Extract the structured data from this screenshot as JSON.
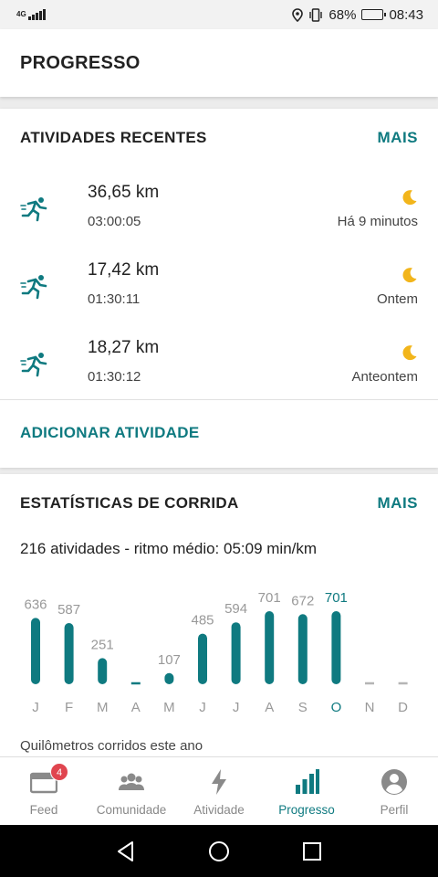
{
  "status_bar": {
    "network": "4G",
    "battery": "68%",
    "battery_level": 0.68,
    "time": "08:43"
  },
  "header": {
    "title": "PROGRESSO"
  },
  "recent": {
    "title": "ATIVIDADES RECENTES",
    "more": "MAIS",
    "items": [
      {
        "distance": "36,65 km",
        "duration": "03:00:05",
        "when": "Há 9 minutos",
        "icon": "runner-icon"
      },
      {
        "distance": "17,42 km",
        "duration": "01:30:11",
        "when": "Ontem",
        "icon": "runner-icon"
      },
      {
        "distance": "18,27 km",
        "duration": "01:30:12",
        "when": "Anteontem",
        "icon": "runner-icon"
      }
    ],
    "add_label": "ADICIONAR ATIVIDADE"
  },
  "stats": {
    "title": "ESTATÍSTICAS DE CORRIDA",
    "more": "MAIS",
    "summary": "216 atividades - ritmo médio: 05:09 min/km",
    "caption": "Quilômetros corridos este ano"
  },
  "chart_data": {
    "type": "bar",
    "categories": [
      "J",
      "F",
      "M",
      "A",
      "M",
      "J",
      "J",
      "A",
      "S",
      "O",
      "N",
      "D"
    ],
    "values": [
      636,
      587,
      251,
      0,
      107,
      485,
      594,
      701,
      672,
      701,
      0,
      0
    ],
    "labels": [
      "636",
      "587",
      "251",
      "",
      "107",
      "485",
      "594",
      "701",
      "672",
      "701",
      "",
      ""
    ],
    "highlight_index": 9,
    "title": "",
    "xlabel": "",
    "ylabel": "",
    "colors": {
      "bar": "#0f7a80",
      "empty": "#b5b5b5",
      "label": "#999999",
      "highlight_label": "#0f7a80"
    }
  },
  "bottom_nav": {
    "items": [
      {
        "label": "Feed",
        "icon": "feed-icon",
        "badge": "4"
      },
      {
        "label": "Comunidade",
        "icon": "community-icon"
      },
      {
        "label": "Atividade",
        "icon": "lightning-icon"
      },
      {
        "label": "Progresso",
        "icon": "bar-chart-icon",
        "active": true
      },
      {
        "label": "Perfil",
        "icon": "profile-icon"
      }
    ]
  },
  "colors": {
    "accent": "#0f7a80",
    "moon": "#f2b51b",
    "badge": "#e0454f"
  }
}
